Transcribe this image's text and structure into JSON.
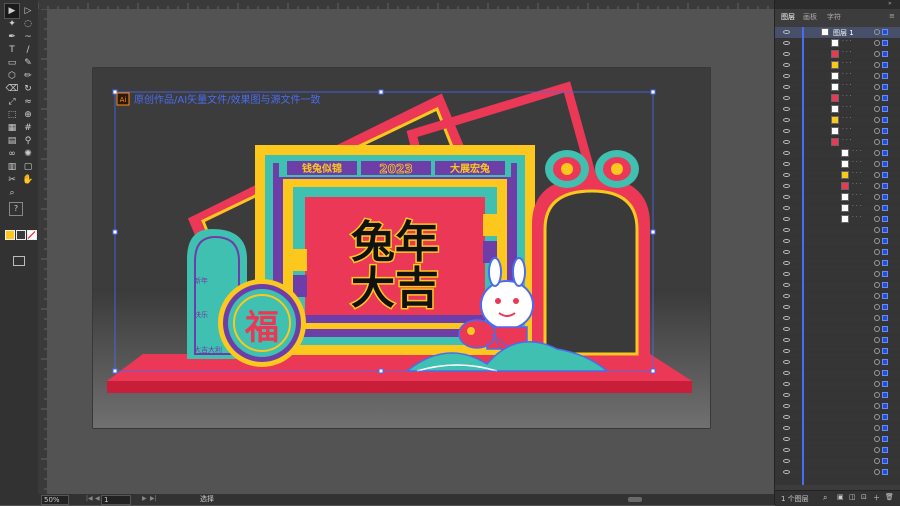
{
  "toolbar": {
    "tools": [
      "selection-tool",
      "direct-selection-tool",
      "magic-wand-tool",
      "lasso-tool",
      "pen-tool",
      "curvature-tool",
      "type-tool",
      "line-tool",
      "rectangle-tool",
      "paintbrush-tool",
      "shaper-tool",
      "pencil-tool",
      "eraser-tool",
      "rotate-tool",
      "scale-tool",
      "width-tool",
      "free-transform-tool",
      "shape-builder-tool",
      "perspective-tool",
      "mesh-tool",
      "gradient-tool",
      "eyedropper-tool",
      "blend-tool",
      "symbol-sprayer-tool",
      "graph-tool",
      "artboard-tool",
      "slice-tool",
      "hand-tool",
      "zoom-tool"
    ],
    "help_label": "?"
  },
  "artwork": {
    "ai_badge": "Ai",
    "headline": "原创作品/AI矢量文件/效果图与源文件一致",
    "banner_left": "钱兔似锦",
    "banner_year": "2023",
    "banner_right": "大展宏兔",
    "title_line1": "兔年",
    "title_line2": "大吉",
    "fu_char": "福",
    "arch_texts": [
      "新年",
      "快乐",
      "大吉大利"
    ]
  },
  "status": {
    "zoom": "50%",
    "artboard": "1",
    "tool_name": "选择"
  },
  "panel": {
    "tabs": [
      "图层",
      "画板",
      "字符"
    ],
    "top_layer_name": "图层 1",
    "footer_count": "1 个图层",
    "row_count": 41
  },
  "colors": {
    "red": "#ea3856",
    "yellow": "#fcc81e",
    "teal": "#3fc0b0",
    "purple": "#6e3ea8",
    "blue_select": "#4a6cf0",
    "dark_bg": "#3e3e3e"
  }
}
